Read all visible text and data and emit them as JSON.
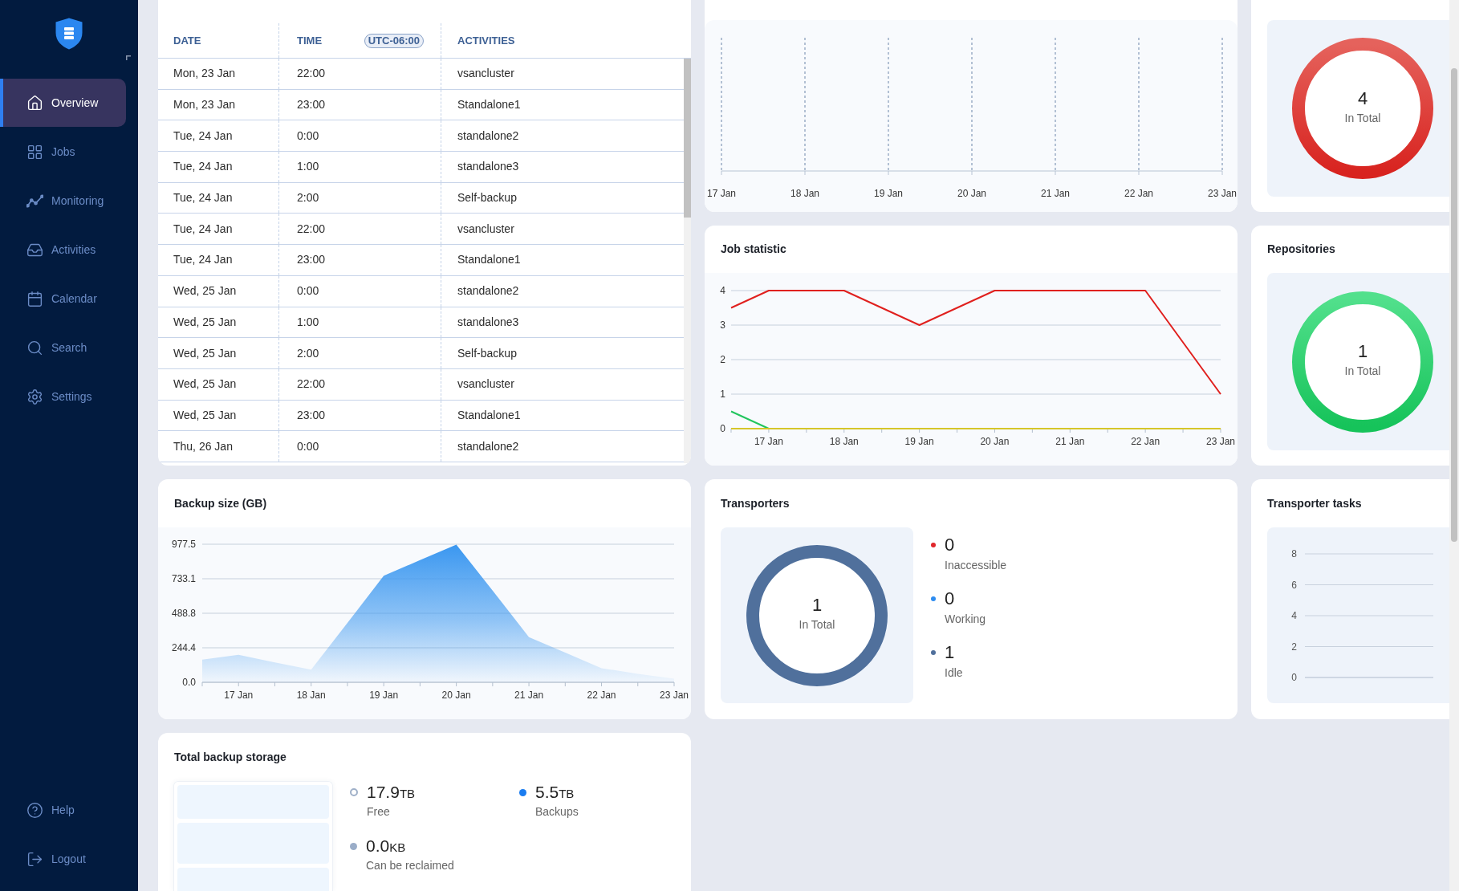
{
  "sidebar": {
    "nav": [
      {
        "label": "Overview",
        "selected": true
      },
      {
        "label": "Jobs",
        "selected": false
      },
      {
        "label": "Monitoring",
        "selected": false
      },
      {
        "label": "Activities",
        "selected": false
      },
      {
        "label": "Calendar",
        "selected": false
      },
      {
        "label": "Search",
        "selected": false
      },
      {
        "label": "Settings",
        "selected": false
      }
    ],
    "footer": [
      {
        "label": "Help"
      },
      {
        "label": "Logout"
      }
    ]
  },
  "schedule_table": {
    "columns": [
      {
        "label": "DATE"
      },
      {
        "label": "TIME",
        "badge": "UTC-06:00"
      },
      {
        "label": "ACTIVITIES"
      }
    ],
    "rows": [
      [
        "Mon, 23 Jan",
        "22:00",
        "vsancluster"
      ],
      [
        "Mon, 23 Jan",
        "23:00",
        "Standalone1"
      ],
      [
        "Tue, 24 Jan",
        "0:00",
        "standalone2"
      ],
      [
        "Tue, 24 Jan",
        "1:00",
        "standalone3"
      ],
      [
        "Tue, 24 Jan",
        "2:00",
        "Self-backup"
      ],
      [
        "Tue, 24 Jan",
        "22:00",
        "vsancluster"
      ],
      [
        "Tue, 24 Jan",
        "23:00",
        "Standalone1"
      ],
      [
        "Wed, 25 Jan",
        "0:00",
        "standalone2"
      ],
      [
        "Wed, 25 Jan",
        "1:00",
        "standalone3"
      ],
      [
        "Wed, 25 Jan",
        "2:00",
        "Self-backup"
      ],
      [
        "Wed, 25 Jan",
        "22:00",
        "vsancluster"
      ],
      [
        "Wed, 25 Jan",
        "23:00",
        "Standalone1"
      ],
      [
        "Thu, 26 Jan",
        "0:00",
        "standalone2"
      ]
    ]
  },
  "timeline": {
    "axis_labels": [
      "17 Jan",
      "18 Jan",
      "19 Jan",
      "20 Jan",
      "21 Jan",
      "22 Jan",
      "23 Jan"
    ]
  },
  "status_summary": {
    "total": "4",
    "total_label": "In Total"
  },
  "job_statistic": {
    "title": "Job statistic",
    "chart_data": {
      "type": "line",
      "categories": [
        null,
        "17 Jan",
        null,
        "18 Jan",
        null,
        "19 Jan",
        null,
        "20 Jan",
        null,
        "21 Jan",
        null,
        "22 Jan",
        null,
        "23 Jan"
      ],
      "ylim": [
        0,
        4
      ],
      "yticks": [
        0,
        1,
        2,
        3,
        4
      ],
      "grid": true,
      "series": [
        {
          "color": "#e0201e",
          "values": [
            3.5,
            4,
            4,
            4,
            3.5,
            3,
            3.5,
            4,
            4,
            4,
            4,
            4,
            2.5,
            1
          ]
        },
        {
          "color": "#22c55e",
          "values": [
            0.5,
            0,
            null,
            null,
            null,
            null,
            null,
            null,
            null,
            null,
            null,
            null,
            null,
            null
          ]
        },
        {
          "color": "#d6c62a",
          "values": [
            0,
            0,
            0,
            0,
            0,
            0,
            0,
            0,
            0,
            0,
            0,
            0,
            0,
            0
          ]
        }
      ]
    }
  },
  "repositories": {
    "title": "Repositories",
    "total": "1",
    "total_label": "In Total"
  },
  "backup_size": {
    "title": "Backup size (GB)",
    "chart_data": {
      "type": "area",
      "categories": [
        null,
        "17 Jan",
        null,
        "18 Jan",
        null,
        "19 Jan",
        null,
        "20 Jan",
        null,
        "21 Jan",
        null,
        "22 Jan",
        null,
        "23 Jan"
      ],
      "ylim": [
        0,
        977.5
      ],
      "yticks": [
        {
          "value": 0,
          "label": "0.0"
        },
        {
          "value": 244.4,
          "label": "244.4"
        },
        {
          "value": 488.8,
          "label": "488.8"
        },
        {
          "value": 733.1,
          "label": "733.1"
        },
        {
          "value": 977.5,
          "label": "977.5"
        }
      ],
      "grid": true,
      "series": [
        {
          "color": "#3a97f0",
          "values": [
            160,
            195,
            140,
            90,
            420,
            755,
            865,
            975,
            650,
            320,
            210,
            100,
            60,
            25
          ]
        }
      ]
    }
  },
  "transporters": {
    "title": "Transporters",
    "total": "1",
    "total_label": "In Total",
    "legend": [
      {
        "value": "0",
        "label": "Inaccessible",
        "color": "#e0262b"
      },
      {
        "value": "0",
        "label": "Working",
        "color": "#2d8cf0"
      },
      {
        "value": "1",
        "label": "Idle",
        "color": "#50709c"
      }
    ]
  },
  "transporter_tasks": {
    "title": "Transporter tasks",
    "axis_labels": [
      "8",
      "6",
      "4",
      "2",
      "0"
    ]
  },
  "total_backup_storage": {
    "title": "Total backup storage",
    "items": [
      {
        "value": "17.9",
        "unit": "TB",
        "label": "Free",
        "color": "#9fb0c8",
        "kind": "outline"
      },
      {
        "value": "5.5",
        "unit": "TB",
        "label": "Backups",
        "color": "#1a7cf0",
        "kind": "solid"
      },
      {
        "value": "0.0",
        "unit": "KB",
        "label": "Can be reclaimed",
        "color": "#9aadc8",
        "kind": "solid"
      }
    ]
  }
}
